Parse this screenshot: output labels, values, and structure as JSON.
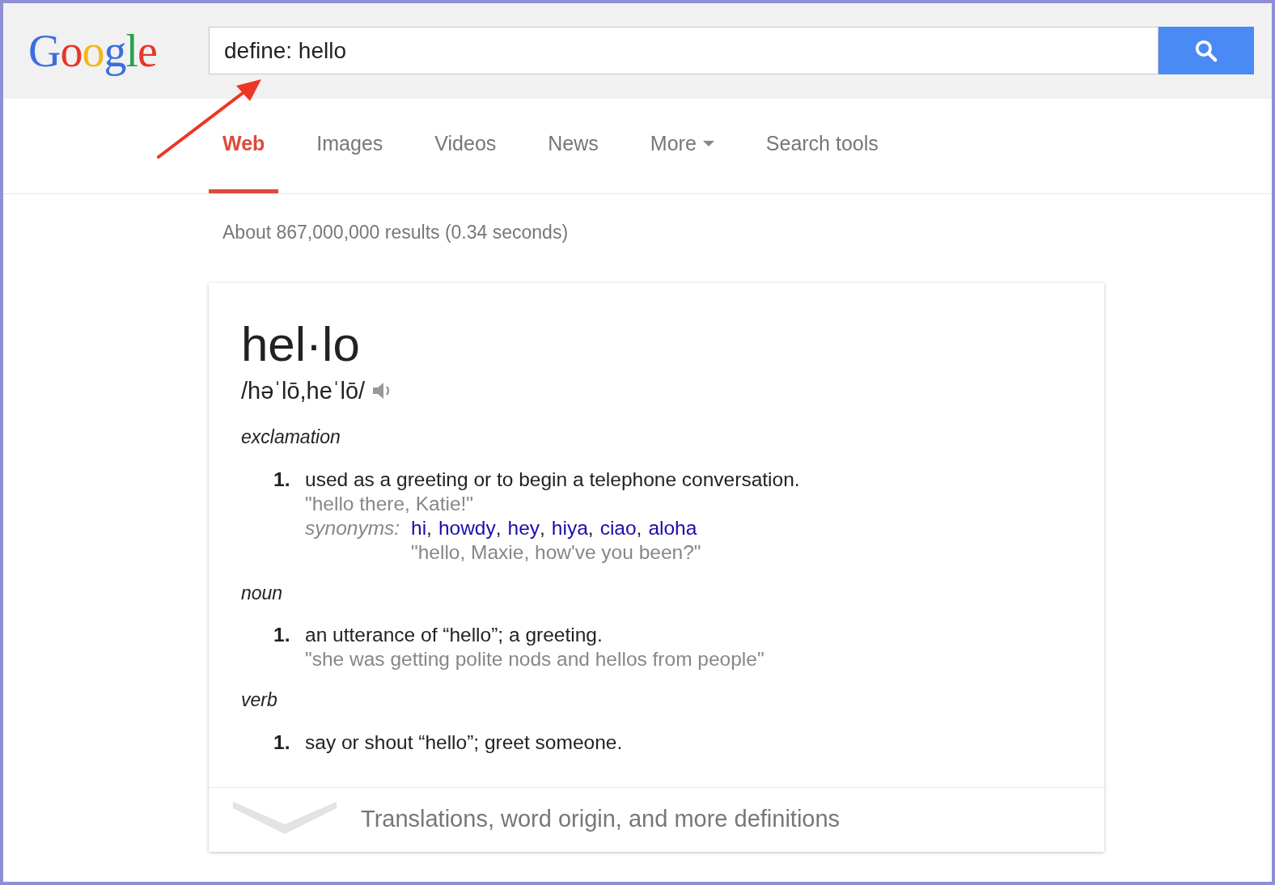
{
  "logo": {
    "letters": [
      {
        "text": "G",
        "color": "#3b6fe0"
      },
      {
        "text": "o",
        "color": "#e4382b"
      },
      {
        "text": "o",
        "color": "#f3b71c"
      },
      {
        "text": "g",
        "color": "#3b6fe0"
      },
      {
        "text": "l",
        "color": "#2aa14a"
      },
      {
        "text": "e",
        "color": "#e4382b"
      }
    ]
  },
  "search": {
    "value": "define: hello"
  },
  "tabs": [
    {
      "label": "Web",
      "selected": true,
      "dropdown": false
    },
    {
      "label": "Images",
      "selected": false,
      "dropdown": false
    },
    {
      "label": "Videos",
      "selected": false,
      "dropdown": false
    },
    {
      "label": "News",
      "selected": false,
      "dropdown": false
    },
    {
      "label": "More",
      "selected": false,
      "dropdown": true
    },
    {
      "label": "Search tools",
      "selected": false,
      "dropdown": false
    }
  ],
  "result_stats": "About 867,000,000 results (0.34 seconds)",
  "definition": {
    "word": "hel·lo",
    "pronunciation": "/həˈlō,heˈlō/",
    "sections": [
      {
        "part_of_speech": "exclamation",
        "senses": [
          {
            "number": "1.",
            "text": "used as a greeting or to begin a telephone conversation.",
            "example": "\"hello there, Katie!\"",
            "synonyms_label": "synonyms:",
            "synonyms": [
              "hi",
              "howdy",
              "hey",
              "hiya",
              "ciao",
              "aloha"
            ],
            "synonym_separator": ",",
            "synonym_example": "\"hello, Maxie, how've you been?\""
          }
        ]
      },
      {
        "part_of_speech": "noun",
        "senses": [
          {
            "number": "1.",
            "text": "an utterance of “hello”; a greeting.",
            "example": "\"she was getting polite nods and hellos from people\""
          }
        ]
      },
      {
        "part_of_speech": "verb",
        "senses": [
          {
            "number": "1.",
            "text": "say or shout “hello”; greet someone."
          }
        ]
      }
    ],
    "more_link": "Translations, word origin, and more definitions"
  }
}
